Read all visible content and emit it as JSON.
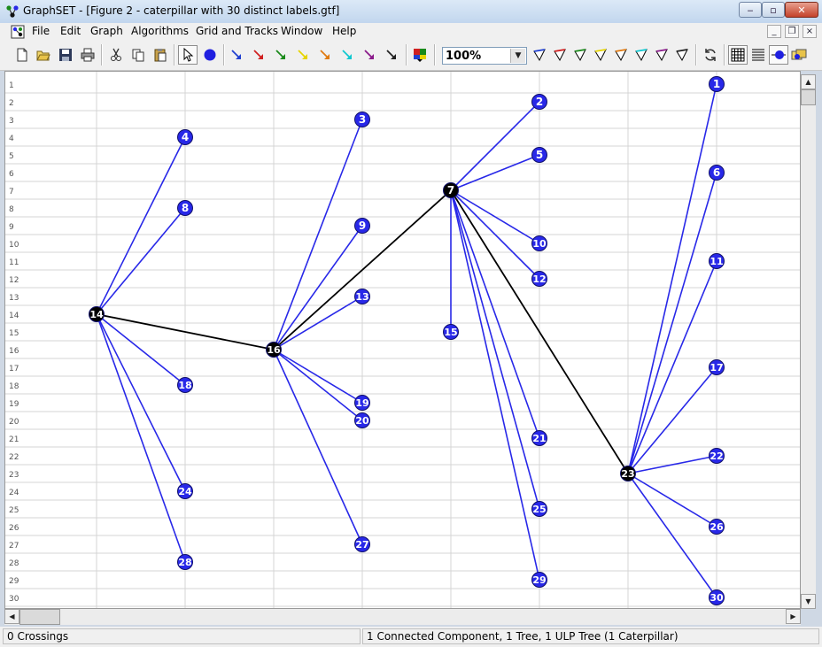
{
  "window": {
    "title": "GraphSET - [Figure 2 - caterpillar with 30 distinct labels.gtf]",
    "controls": {
      "minimize": "‒",
      "maximize": "▫",
      "close": "✕"
    }
  },
  "menu": {
    "items": [
      "File",
      "Edit",
      "Graph",
      "Algorithms",
      "Grid and Tracks",
      "Window",
      "Help"
    ],
    "mdi_controls": {
      "minimize": "_",
      "restore": "❐",
      "close": "×"
    }
  },
  "toolbar": {
    "zoom_value": "100%",
    "edge_colors": [
      "#1f3fd0",
      "#d02020",
      "#1a8a1a",
      "#e6d400",
      "#e07a10",
      "#10c8d0",
      "#8a1a8a",
      "#222222"
    ]
  },
  "ruler": {
    "rows": [
      "1",
      "2",
      "3",
      "4",
      "5",
      "6",
      "7",
      "8",
      "9",
      "10",
      "11",
      "12",
      "13",
      "14",
      "15",
      "16",
      "17",
      "18",
      "19",
      "20",
      "21",
      "22",
      "23",
      "24",
      "25",
      "26",
      "27",
      "28",
      "29",
      "30"
    ]
  },
  "graph": {
    "colors": {
      "spine": "#000000",
      "leaf": "#2828e8",
      "edge_leaf": "#2828e8",
      "edge_spine": "#000000",
      "label": "#ffffff"
    },
    "spine_nodes": [
      {
        "label": "14",
        "col": 1,
        "row": 14
      },
      {
        "label": "16",
        "col": 3,
        "row": 16
      },
      {
        "label": "7",
        "col": 5,
        "row": 7
      },
      {
        "label": "23",
        "col": 7,
        "row": 23
      }
    ],
    "leaf_nodes": [
      {
        "label": "4",
        "col": 2,
        "row": 4,
        "parent": "14"
      },
      {
        "label": "8",
        "col": 2,
        "row": 8,
        "parent": "14"
      },
      {
        "label": "18",
        "col": 2,
        "row": 18,
        "parent": "14"
      },
      {
        "label": "24",
        "col": 2,
        "row": 24,
        "parent": "14"
      },
      {
        "label": "28",
        "col": 2,
        "row": 28,
        "parent": "14"
      },
      {
        "label": "3",
        "col": 4,
        "row": 3,
        "parent": "16"
      },
      {
        "label": "9",
        "col": 4,
        "row": 9,
        "parent": "16"
      },
      {
        "label": "13",
        "col": 4,
        "row": 13,
        "parent": "16"
      },
      {
        "label": "19",
        "col": 4,
        "row": 19,
        "parent": "16"
      },
      {
        "label": "20",
        "col": 4,
        "row": 20,
        "parent": "16"
      },
      {
        "label": "27",
        "col": 4,
        "row": 27,
        "parent": "16"
      },
      {
        "label": "2",
        "col": 6,
        "row": 2,
        "parent": "7"
      },
      {
        "label": "5",
        "col": 6,
        "row": 5,
        "parent": "7"
      },
      {
        "label": "10",
        "col": 6,
        "row": 10,
        "parent": "7"
      },
      {
        "label": "12",
        "col": 6,
        "row": 12,
        "parent": "7"
      },
      {
        "label": "15",
        "col": 5,
        "row": 15,
        "parent": "7"
      },
      {
        "label": "21",
        "col": 6,
        "row": 21,
        "parent": "7"
      },
      {
        "label": "25",
        "col": 6,
        "row": 25,
        "parent": "7"
      },
      {
        "label": "29",
        "col": 6,
        "row": 29,
        "parent": "7"
      },
      {
        "label": "1",
        "col": 8,
        "row": 1,
        "parent": "23"
      },
      {
        "label": "6",
        "col": 8,
        "row": 6,
        "parent": "23"
      },
      {
        "label": "11",
        "col": 8,
        "row": 11,
        "parent": "23"
      },
      {
        "label": "17",
        "col": 8,
        "row": 17,
        "parent": "23"
      },
      {
        "label": "22",
        "col": 8,
        "row": 22,
        "parent": "23"
      },
      {
        "label": "26",
        "col": 8,
        "row": 26,
        "parent": "23"
      },
      {
        "label": "30",
        "col": 8,
        "row": 30,
        "parent": "23"
      }
    ]
  },
  "status": {
    "crossings": "0 Crossings",
    "summary": "1 Connected Component, 1 Tree, 1 ULP Tree (1 Caterpillar)"
  }
}
